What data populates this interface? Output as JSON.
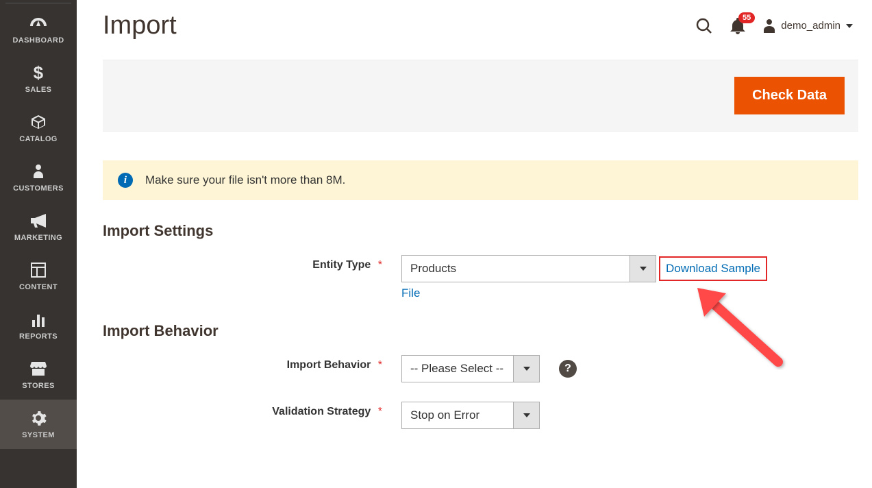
{
  "sidebar": {
    "items": [
      {
        "label": "DASHBOARD"
      },
      {
        "label": "SALES"
      },
      {
        "label": "CATALOG"
      },
      {
        "label": "CUSTOMERS"
      },
      {
        "label": "MARKETING"
      },
      {
        "label": "CONTENT"
      },
      {
        "label": "REPORTS"
      },
      {
        "label": "STORES"
      },
      {
        "label": "SYSTEM"
      }
    ]
  },
  "header": {
    "title": "Import",
    "notification_count": "55",
    "username": "demo_admin"
  },
  "actions": {
    "check_data": "Check Data"
  },
  "banner": {
    "message": "Make sure your file isn't more than 8M."
  },
  "sections": {
    "import_settings": {
      "title": "Import Settings",
      "entity_type": {
        "label": "Entity Type",
        "value": "Products",
        "download_sample": "Download Sample File"
      }
    },
    "import_behavior": {
      "title": "Import Behavior",
      "behavior": {
        "label": "Import Behavior",
        "value": "-- Please Select --"
      },
      "validation": {
        "label": "Validation Strategy",
        "value": "Stop on Error"
      }
    }
  }
}
